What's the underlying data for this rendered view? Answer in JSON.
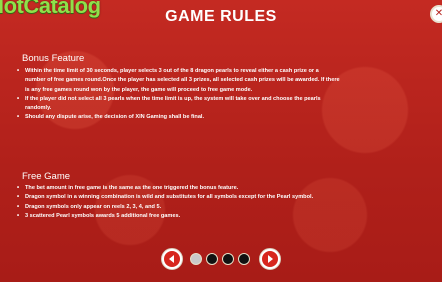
{
  "header": {
    "logo_text": "lotCatalog",
    "title": "GAME RULES",
    "close_icon": "close-icon"
  },
  "bonus_feature": {
    "heading": "Bonus Feature",
    "items": [
      "Within the time limit of 30 seconds, player selects 3 out of the 8 dragon pearls to reveal either a cash prize or a",
      "number of free games round.Once the player has selected all 3 prizes, all selected cash prizes will be awarded. If there",
      "is any free games round won by the player, the game will proceed to free game mode.",
      "If the player did not select all 3 pearls when the time limit is up, the system will take over and choose the pearls",
      "randomly.",
      "Should any dispute arise, the decision of XIN Gaming shall be final."
    ],
    "bullets": [
      true,
      false,
      false,
      true,
      false,
      true
    ]
  },
  "free_game": {
    "heading": "Free Game",
    "items": [
      "The bet amount in free game is the same as the one triggered the bonus feature.",
      "Dragon symbol in a winning combination is wild and substitutes for all symbols except for the Pearl symbol.",
      "Dragon symbols only appear on reels 2, 3, 4, and 5.",
      "3 scattered Pearl symbols awards 5 additional free games."
    ]
  },
  "pagination": {
    "total_pages": 4,
    "current_page": 1,
    "prev_icon": "arrow-left-icon",
    "next_icon": "arrow-right-icon"
  },
  "colors": {
    "background": "#b5221c",
    "text": "#ffffff",
    "logo": "#8fe04a",
    "button_red": "#d7261e"
  }
}
